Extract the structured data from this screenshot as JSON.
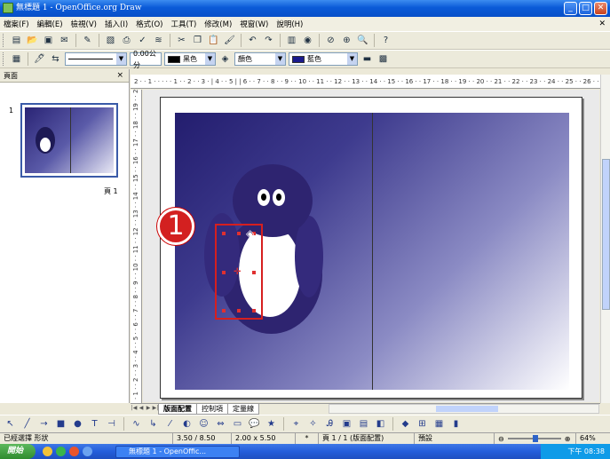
{
  "window": {
    "title": "無標題 1 - OpenOffice.org Draw",
    "controls": [
      "_",
      "□",
      "✕"
    ]
  },
  "menu": {
    "items": [
      "檔案(F)",
      "編輯(E)",
      "檢視(V)",
      "插入(I)",
      "格式(O)",
      "工具(T)",
      "修改(M)",
      "視窗(W)",
      "說明(H)"
    ],
    "close": "✕"
  },
  "toolbar2": {
    "line_width": "0.00公分",
    "line_color": "黑色",
    "area_style": "顏色",
    "area_color": "藍色"
  },
  "panel": {
    "title": "頁面",
    "close": "×",
    "slide_number": "1",
    "page_caption": "頁 1"
  },
  "ruler": {
    "horizontal": "2 · · 1 · · · · · 1 · · 2 · · 3 · | 4 · · 5 | | 6 · · 7 · · 8 · · 9 · · 10 · · 11 · · 12 · · 13 · · 14 · · 15 · · 16 · · 17 · · 18 · · 19 · · 20 · · 21 · · 22 · · 23 · · 24 · · 25 · · 26 · · 27 · · 28 · 29",
    "vertical": "· 1 · · 2 · · 3 · · 4 · · 5 · · 6 · · 7 · · 8 · · 9 · · 10 · · 11 · · 12 · · 13 · · 14 · · 15 · · 16 · · 17 · · 18 · · 19 · · 20"
  },
  "callout": {
    "number": "1"
  },
  "tabs": [
    "版面配置",
    "控制項",
    "定量線"
  ],
  "status": {
    "selection": "已經選擇 形狀",
    "position": "3.50 / 8.50",
    "size": "2.00 x 5.50",
    "modified": "*",
    "page": "頁 1 / 1 (版面配置)",
    "style": "預設",
    "zoom": "64%"
  },
  "taskbar": {
    "start": "開始",
    "task": "無標題 1 - OpenOffic...",
    "clock": "下午 08:38"
  },
  "colors": {
    "selection": "#d61f1f",
    "penguin": "#2e2470",
    "gradient_dark": "#231d6e"
  }
}
